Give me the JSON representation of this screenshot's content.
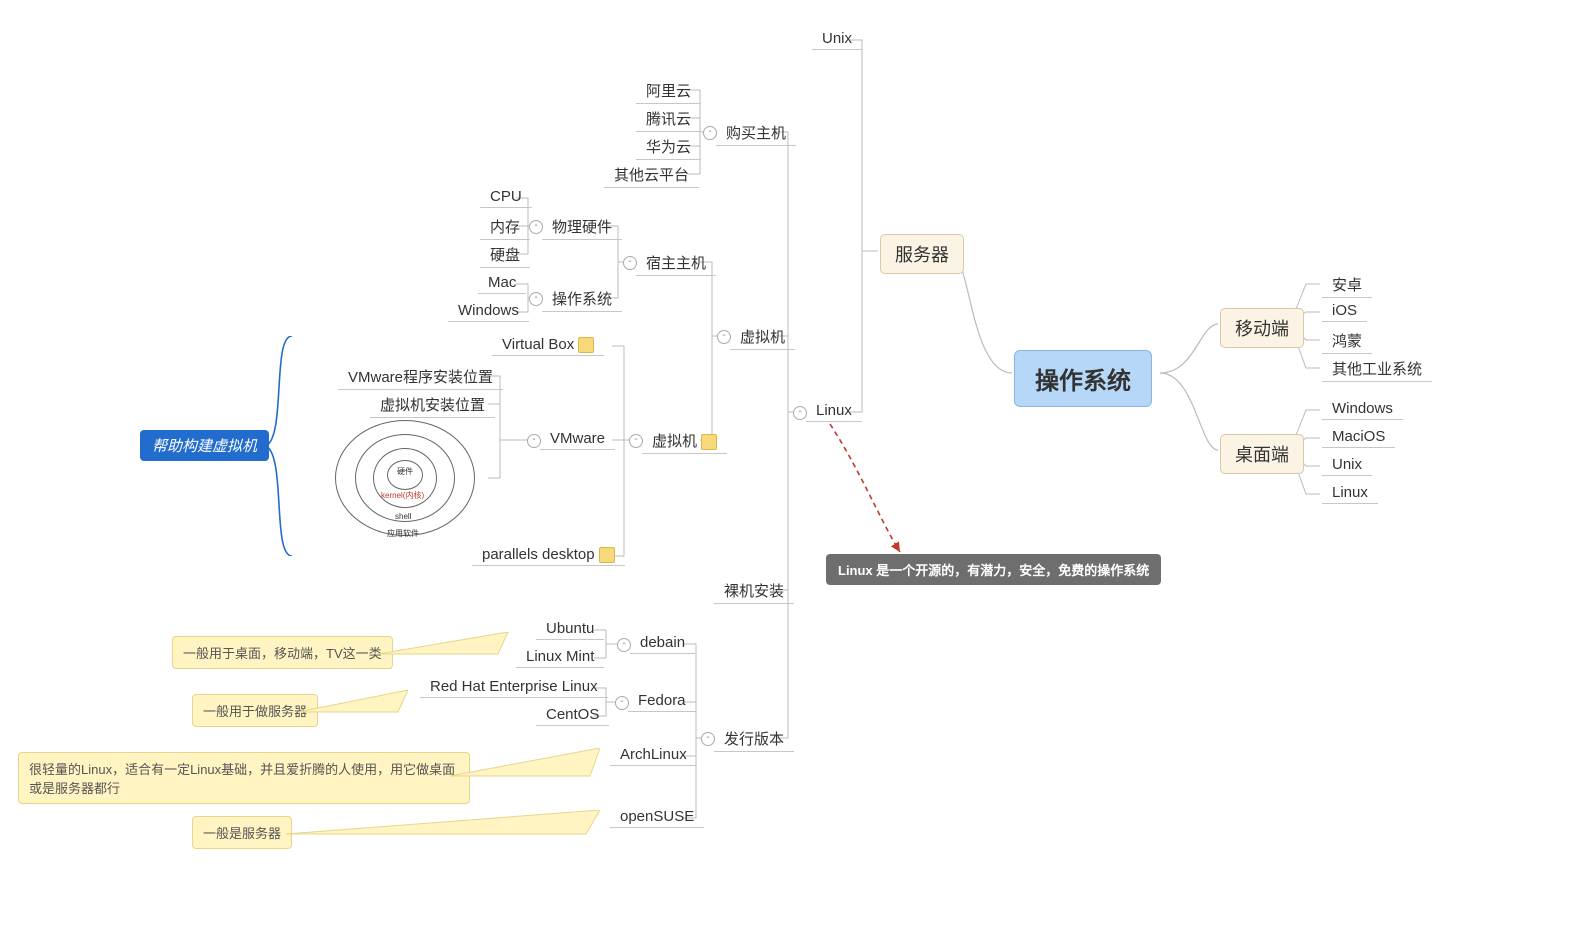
{
  "root": "操作系统",
  "mobile": {
    "label": "移动端",
    "items": [
      "安卓",
      "iOS",
      "鸿蒙",
      "其他工业系统"
    ]
  },
  "desktop": {
    "label": "桌面端",
    "items": [
      "Windows",
      "MaciOS",
      "Unix",
      "Linux"
    ]
  },
  "server": {
    "label": "服务器",
    "unix": "Unix",
    "linux": "Linux"
  },
  "buyhost": {
    "label": "购买主机",
    "items": [
      "阿里云",
      "腾讯云",
      "华为云",
      "其他云平台"
    ]
  },
  "vm": {
    "label": "虚拟机",
    "host": "宿主主机",
    "vmsoft": "虚拟机"
  },
  "hw": {
    "label": "物理硬件",
    "items": [
      "CPU",
      "内存",
      "硬盘"
    ]
  },
  "os": {
    "label": "操作系统",
    "items": [
      "Mac",
      "Windows"
    ]
  },
  "vbox": "Virtual Box",
  "vmware": {
    "label": "VMware",
    "items": [
      "VMware程序安装位置",
      "虚拟机安装位置"
    ]
  },
  "parallels": "parallels desktop",
  "bare": "裸机安装",
  "dist": {
    "label": "发行版本",
    "debian": {
      "label": "debain",
      "items": [
        "Ubuntu",
        "Linux Mint"
      ]
    },
    "fedora": {
      "label": "Fedora",
      "items": [
        "Red Hat Enterprise Linux",
        "CentOS"
      ]
    },
    "arch": "ArchLinux",
    "suse": "openSUSE"
  },
  "callout": "Linux 是一个开源的，有潜力，安全，免费的操作系统",
  "tag": "帮助构建虚拟机",
  "sticker1": "一般用于桌面，移动端，TV这一类",
  "sticker2": "一般用于做服务器",
  "sticker3": "很轻量的Linux，适合有一定Linux基础，并且爱折腾的人使用，用它做桌面或是服务器都行",
  "sticker4": "一般是服务器",
  "rings": {
    "l1": "硬件",
    "l2": "kernel(内核)",
    "l3": "shell",
    "l4": "应用软件"
  }
}
